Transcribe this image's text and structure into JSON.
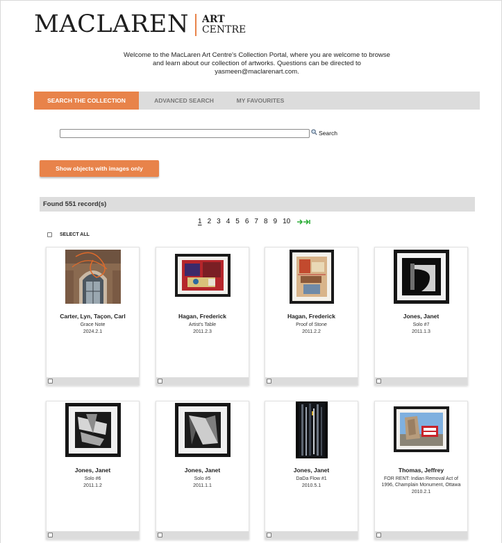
{
  "logo": {
    "main": "MACLAREN",
    "art": "ART",
    "centre": "CENTRE"
  },
  "welcome": {
    "line1": "Welcome to the MacLaren Art Centre's Collection Portal, where you are welcome to browse",
    "line2": "and learn about our collection of artworks. Questions can be directed to",
    "email": "yasmeen@maclarenart.com."
  },
  "tabs": [
    {
      "label": "SEARCH THE COLLECTION",
      "active": true
    },
    {
      "label": "ADVANCED SEARCH",
      "active": false
    },
    {
      "label": "MY FAVOURITES",
      "active": false
    }
  ],
  "search": {
    "value": "",
    "placeholder": "",
    "button_label": "Search"
  },
  "images_only_label": "Show objects with images only",
  "results": {
    "found_label": "Found 551 record(s)"
  },
  "pagination": {
    "current": "1",
    "pages": [
      "2",
      "3",
      "4",
      "5",
      "6",
      "7",
      "8",
      "9",
      "10"
    ]
  },
  "select_all_label": "SELECT ALL",
  "cards": [
    {
      "artist": "Carter, Lyn, Taçon, Carl",
      "title": "Grace Note",
      "accession": "2024.2.1"
    },
    {
      "artist": "Hagan, Frederick",
      "title": "Artist's Table",
      "accession": "2011.2.3"
    },
    {
      "artist": "Hagan, Frederick",
      "title": "Proof of Stone",
      "accession": "2011.2.2"
    },
    {
      "artist": "Jones, Janet",
      "title": "Solo #7",
      "accession": "2011.1.3"
    },
    {
      "artist": "Jones, Janet",
      "title": "Solo #6",
      "accession": "2011.1.2"
    },
    {
      "artist": "Jones, Janet",
      "title": "Solo #5",
      "accession": "2011.1.1"
    },
    {
      "artist": "Jones, Janet",
      "title": "DaDa Flow #1",
      "accession": "2010.5.1"
    },
    {
      "artist": "Thomas, Jeffrey",
      "title": "FOR RENT: Indian Removal Act of 1996, Champlain Monument, Ottawa",
      "accession": "2010.2.1"
    }
  ],
  "colors": {
    "accent": "#e8834a",
    "tab_bar": "#dcdcdc",
    "results_bar": "#dddddd"
  }
}
